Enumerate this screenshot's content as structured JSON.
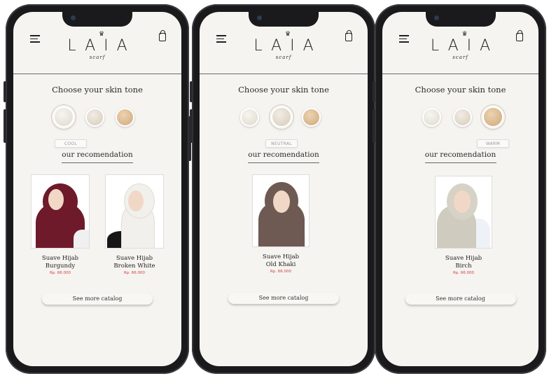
{
  "screens": [
    {
      "brand": "LAIA",
      "brand_sub": "scarf",
      "skin_title": "Choose your skin tone",
      "selected_tone": "COOL",
      "reco_title": "our recomendation",
      "catalog_label": "See more catalog",
      "products": [
        {
          "name1": "Suave Hijab",
          "name2": "Burgundy",
          "price": "Rp. 66.000",
          "color": "#6e1a2a"
        },
        {
          "name1": "Suave Hijab",
          "name2": "Broken White",
          "price": "Rp. 66.000",
          "color": "#f0eeea"
        }
      ]
    },
    {
      "brand": "LAIA",
      "brand_sub": "scarf",
      "skin_title": "Choose your skin tone",
      "selected_tone": "NEUTRAL",
      "reco_title": "our recomendation",
      "catalog_label": "See more catalog",
      "products": [
        {
          "name1": "Suave Hijab",
          "name2": "Old Khaki",
          "price": "Rp. 66.000",
          "color": "#6e5a52"
        }
      ]
    },
    {
      "brand": "LAIA",
      "brand_sub": "scarf",
      "skin_title": "Choose your skin tone",
      "selected_tone": "WARM",
      "reco_title": "our recomendation",
      "catalog_label": "See more catalog",
      "products": [
        {
          "name1": "Suave Hijab",
          "name2": "Birch",
          "price": "Rp. 66.000",
          "color": "#cfcbbf"
        }
      ]
    }
  ],
  "tone_colors": {
    "cool": "#e4e2d8",
    "neutral": "#ddd2c2",
    "warm": "#d9b890"
  },
  "price_color": "#d04040"
}
